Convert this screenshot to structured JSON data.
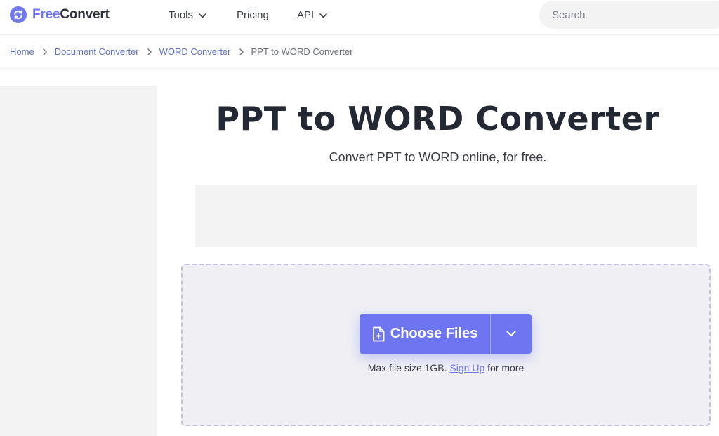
{
  "header": {
    "logo": {
      "free": "Free",
      "convert": "Convert"
    },
    "nav": {
      "tools": "Tools",
      "pricing": "Pricing",
      "api": "API"
    },
    "search": {
      "placeholder": "Search",
      "value": ""
    }
  },
  "breadcrumb": {
    "home": "Home",
    "document": "Document Converter",
    "word": "WORD Converter",
    "current": "PPT to WORD Converter"
  },
  "main": {
    "title": "PPT to WORD Converter",
    "subtitle": "Convert PPT to WORD online, for free.",
    "choose_files": "Choose Files",
    "max_size": "Max file size 1GB.",
    "sign_up": "Sign Up",
    "for_more": "for more"
  },
  "colors": {
    "accent": "#6d75f0",
    "dropzone_bg": "#efeff4",
    "title_text": "#232833"
  },
  "icons": [
    "refresh-icon",
    "chevron-down-icon",
    "chevron-right-icon",
    "file-plus-icon"
  ]
}
